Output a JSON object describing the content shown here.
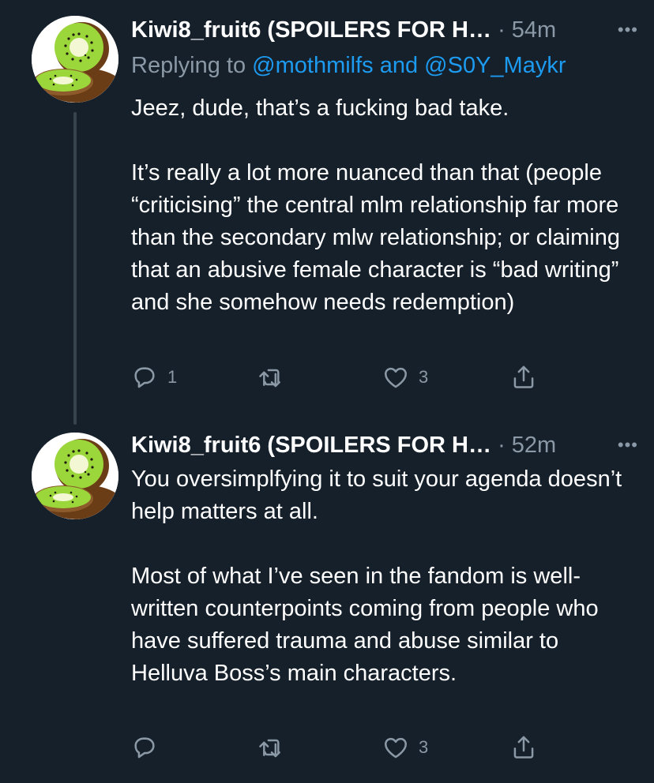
{
  "tweets": [
    {
      "display_name": "Kiwi8_fruit6 (SPOILERS FOR H…",
      "separator": "·",
      "time": "54m",
      "more": "•••",
      "replying_prefix": "Replying to ",
      "mention_1": "@mothmilfs",
      "mention_joiner": " and ",
      "mention_2": "@S0Y_Maykr",
      "paragraphs": [
        "Jeez, dude, that’s a fucking bad take.",
        "It’s really a lot more nuanced than that (people “criticising” the central mlm relationship far more than the secondary mlw relationship; or claiming that an abusive female character is “bad writing” and she somehow needs redemption)"
      ],
      "reply_count": "1",
      "retweet_count": "",
      "like_count": "3"
    },
    {
      "display_name": "Kiwi8_fruit6 (SPOILERS FOR H…",
      "separator": "·",
      "time": "52m",
      "more": "•••",
      "paragraphs": [
        "You oversimplfying it to suit your agenda doesn’t help matters at all.",
        "Most of what I’ve seen in the fandom is well-written counterpoints coming from people who have suffered trauma and abuse similar to Helluva Boss’s main characters."
      ],
      "reply_count": "",
      "retweet_count": "",
      "like_count": "3"
    }
  ],
  "icons": {
    "avatar": "kiwi-fruit-avatar",
    "reply": "reply-icon",
    "retweet": "retweet-icon",
    "like": "heart-icon",
    "share": "share-icon",
    "more": "more-icon"
  },
  "colors": {
    "background": "#15202b",
    "text": "#ffffff",
    "muted": "#8b98a5",
    "link": "#1d9bf0",
    "thread_line": "#38444d"
  }
}
